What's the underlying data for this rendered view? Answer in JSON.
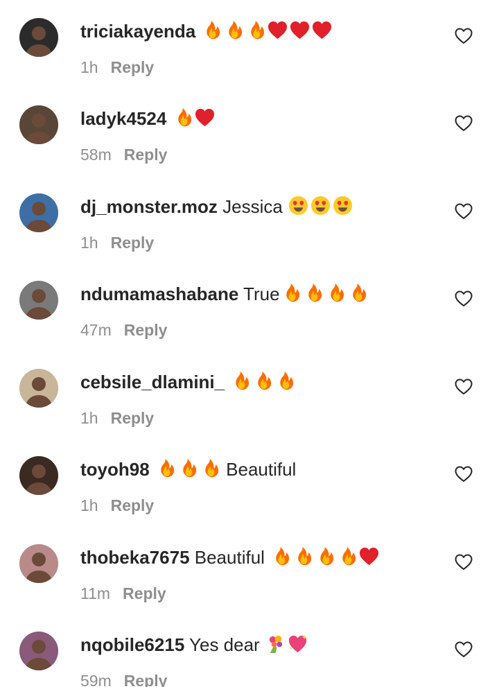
{
  "comments": [
    {
      "username": "triciakayenda",
      "text": " ",
      "emojis_after": [
        "fire",
        "fire",
        "fire",
        "heart",
        "heart",
        "heart"
      ],
      "time": "1h",
      "reply_label": "Reply",
      "avatar_color": "#2b2b2b"
    },
    {
      "username": "ladyk4524",
      "text": " ",
      "emojis_after": [
        "fire",
        "heart"
      ],
      "time": "58m",
      "reply_label": "Reply",
      "avatar_color": "#5a4636"
    },
    {
      "username": "dj_monster.moz",
      "text": " Jessica ",
      "emojis_after": [
        "heart-eyes",
        "heart-eyes",
        "heart-eyes"
      ],
      "time": "1h",
      "reply_label": "Reply",
      "avatar_color": "#3d6fa6"
    },
    {
      "username": "ndumamashabane",
      "text": " True",
      "emojis_after": [
        "fire",
        "fire",
        "fire",
        "fire"
      ],
      "time": "47m",
      "reply_label": "Reply",
      "avatar_color": "#7a7a7a"
    },
    {
      "username": "cebsile_dlamini_",
      "text": " ",
      "emojis_after": [
        "fire",
        "fire",
        "fire"
      ],
      "time": "1h",
      "reply_label": "Reply",
      "avatar_color": "#c9b59a"
    },
    {
      "username": "toyoh98",
      "text": " ",
      "emojis_after": [
        "fire",
        "fire",
        "fire"
      ],
      "text_after": " Beautiful",
      "time": "1h",
      "reply_label": "Reply",
      "avatar_color": "#3a2a22"
    },
    {
      "username": "thobeka7675",
      "text": " Beautiful ",
      "emojis_after": [
        "fire",
        "fire",
        "fire",
        "fire",
        "heart"
      ],
      "time": "11m",
      "reply_label": "Reply",
      "avatar_color": "#b98a8a"
    },
    {
      "username": "nqobile6215",
      "text": " Yes dear ",
      "emojis_after": [
        "bouquet",
        "sparkling-heart"
      ],
      "time": "59m",
      "reply_label": "Reply",
      "avatar_color": "#8a5a7a"
    }
  ],
  "colors": {
    "text": "#262626",
    "muted": "#8e8e8e",
    "fire": "#f4511e",
    "heart": "#e0202a"
  }
}
